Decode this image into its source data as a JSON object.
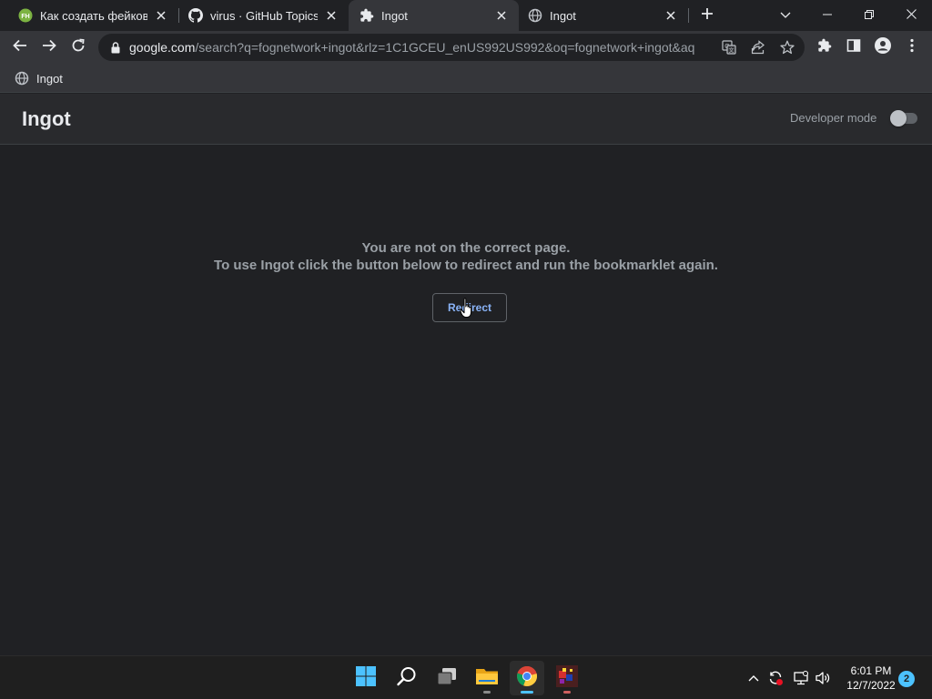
{
  "tabs": [
    {
      "title": "Как создать фейковое",
      "favicon": "green-site-icon"
    },
    {
      "title": "virus · GitHub Topics · G",
      "favicon": "github-icon"
    },
    {
      "title": "Ingot",
      "favicon": "puzzle-icon",
      "active": true
    },
    {
      "title": "Ingot",
      "favicon": "globe-icon"
    }
  ],
  "toolbar": {
    "url_host": "google.com",
    "url_path": "/search?q=fognetwork+ingot&rlz=1C1GCEU_enUS992US992&oq=fognetwork+ingot&aq"
  },
  "bookmarks": [
    {
      "label": "Ingot",
      "icon": "globe-icon"
    }
  ],
  "page": {
    "title": "Ingot",
    "developer_mode_label": "Developer mode",
    "developer_mode_on": false,
    "message_line1": "You are not on the correct page.",
    "message_line2": "To use Ingot click the button below to redirect and run the bookmarklet again.",
    "redirect_button": "Redirect"
  },
  "taskbar": {
    "apps": [
      "windows-start-icon",
      "search-icon",
      "task-view-icon",
      "file-explorer-icon",
      "chrome-icon",
      "app-icon"
    ],
    "time": "6:01 PM",
    "date": "12/7/2022",
    "notification_count": "2"
  },
  "colors": {
    "background": "#202124",
    "header": "#292a2d",
    "toolbar": "#35363a",
    "accent": "#8ab4f8",
    "taskbar_accent": "#4cc2ff"
  }
}
